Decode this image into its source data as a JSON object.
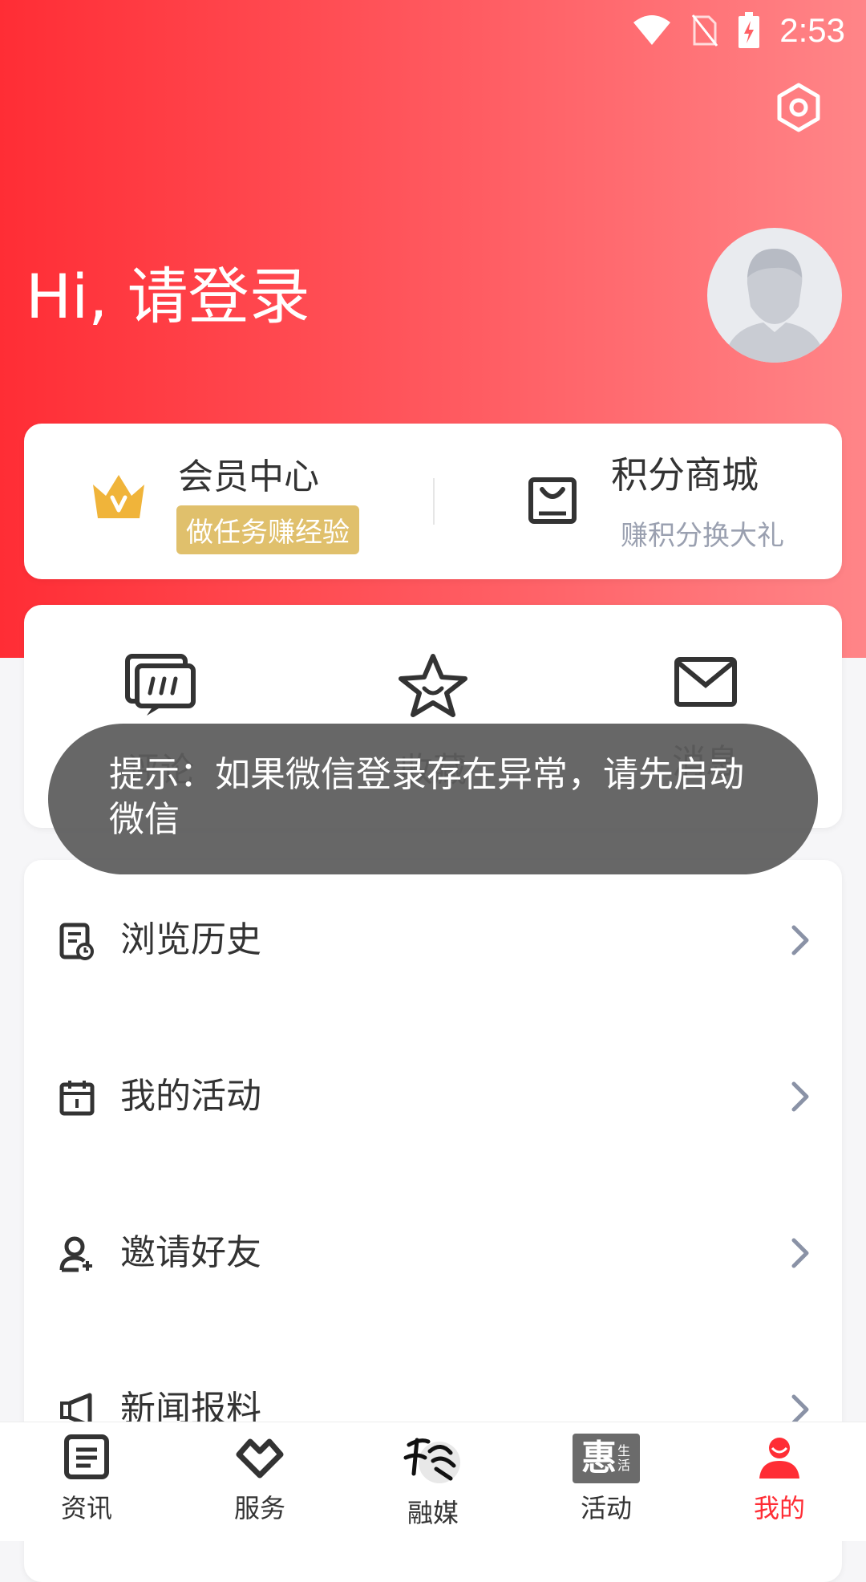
{
  "status_bar": {
    "time": "2:53",
    "icons": [
      "wifi-icon",
      "no-sim-icon",
      "battery-charging-icon"
    ]
  },
  "header": {
    "greeting": "Hi, 请登录",
    "settings_icon": "settings-hexagon-icon",
    "avatar_icon": "default-avatar-icon"
  },
  "member_card": {
    "member": {
      "title": "会员中心",
      "badge": "做任务赚经验",
      "icon": "crown-icon"
    },
    "mall": {
      "title": "积分商城",
      "subtitle": "赚积分换大礼",
      "icon": "shopping-bag-icon"
    }
  },
  "quick_actions": [
    {
      "label": "评论",
      "icon": "comment-icon"
    },
    {
      "label": "收藏",
      "icon": "star-icon"
    },
    {
      "label": "消息",
      "icon": "mail-icon"
    }
  ],
  "menu": [
    {
      "label": "浏览历史",
      "icon": "history-icon"
    },
    {
      "label": "我的活动",
      "icon": "calendar-icon"
    },
    {
      "label": "邀请好友",
      "icon": "add-user-icon"
    },
    {
      "label": "新闻报料",
      "icon": "megaphone-icon"
    }
  ],
  "toast": {
    "text": "提示：如果微信登录存在异常，请先启动微信"
  },
  "tabbar": [
    {
      "label": "资讯",
      "icon": "news-icon"
    },
    {
      "label": "服务",
      "icon": "service-heart-icon"
    },
    {
      "label": "融媒",
      "icon": "calligraphy-logo-icon"
    },
    {
      "label": "活动",
      "icon": "hui-life-logo-icon",
      "logo_text": "惠",
      "logo_sub": "生活"
    },
    {
      "label": "我的",
      "icon": "user-icon",
      "active": true
    }
  ],
  "colors": {
    "accent": "#ff2d35",
    "gold": "#e0c06c"
  }
}
